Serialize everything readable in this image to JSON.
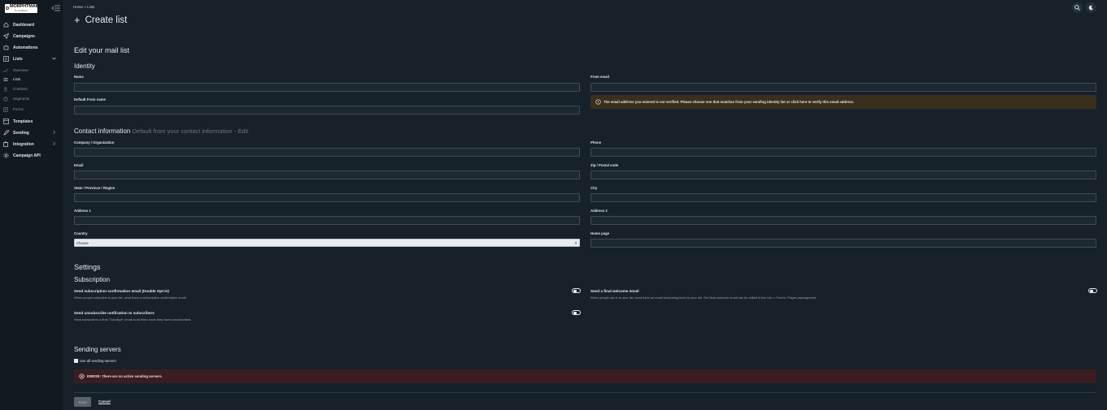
{
  "app": {
    "logo_text": "MORPHTMAIL",
    "logo_sub": "by YourBrand"
  },
  "sidebar": {
    "items": [
      {
        "label": "Dashboard",
        "icon": "home-icon"
      },
      {
        "label": "Campaigns",
        "icon": "send-icon"
      },
      {
        "label": "Automations",
        "icon": "robot-icon"
      },
      {
        "label": "Lists",
        "icon": "list-icon"
      },
      {
        "label": "Templates",
        "icon": "template-icon"
      },
      {
        "label": "Sending",
        "icon": "rocket-icon"
      },
      {
        "label": "Integration",
        "icon": "puzzle-icon"
      },
      {
        "label": "Campaign API",
        "icon": "gear-icon"
      }
    ],
    "lists_sub": [
      {
        "label": "Overview"
      },
      {
        "label": "Lists"
      },
      {
        "label": "Contacts"
      },
      {
        "label": "Segments"
      },
      {
        "label": "Forms"
      }
    ]
  },
  "breadcrumb": {
    "home": "Home",
    "sep": "»",
    "current": "Lists"
  },
  "page": {
    "title": "Create list"
  },
  "form": {
    "section_title": "Edit your mail list",
    "identity": {
      "title": "Identity",
      "name_label": "Name",
      "from_email_label": "From email",
      "default_from_name_label": "Default From name",
      "warning": "The email address you entered is not verified. Please choose one that matches from your sending identity list or click here to verify this email address."
    },
    "contact": {
      "title": "Contact information",
      "subtitle": "Default from your contact information - Edit",
      "company_label": "Company / Organization",
      "phone_label": "Phone",
      "email_label": "Email",
      "zip_label": "Zip / Postal code",
      "state_label": "State / Province / Region",
      "city_label": "City",
      "address1_label": "Address 1",
      "address2_label": "Address 2",
      "country_label": "Country",
      "country_value": "Choose",
      "homepage_label": "Home page"
    },
    "settings": {
      "title": "Settings",
      "subscription_title": "Subscription",
      "double_optin_title": "Send subscription confirmation email (Double Opt-in)",
      "double_optin_desc": "When people subscribe to your list, send them a subscription confirmation email.",
      "welcome_title": "Send a final welcome email",
      "welcome_desc": "When people opt-in to your list, send them an email welcoming them to your list. The final welcome email can be edited in the List -> Forms / Pages management",
      "unsubscribe_title": "Send unsubscribe notification to subscribers",
      "unsubscribe_desc": "Send subscribers a final \"Goodbye\" email to let them know they have unsubscribed."
    },
    "sending": {
      "title": "Sending servers",
      "use_all_label": "Use all sending servers",
      "use_all_checked": true,
      "error": "ERROR: There are no active sending servers."
    },
    "actions": {
      "save_label": "Save",
      "cancel_label": "Cancel"
    }
  },
  "colors": {
    "background": "#16212a",
    "sidebar": "#121a20",
    "warning_bg": "#3a2e1c",
    "error_bg": "#3b1d21"
  }
}
